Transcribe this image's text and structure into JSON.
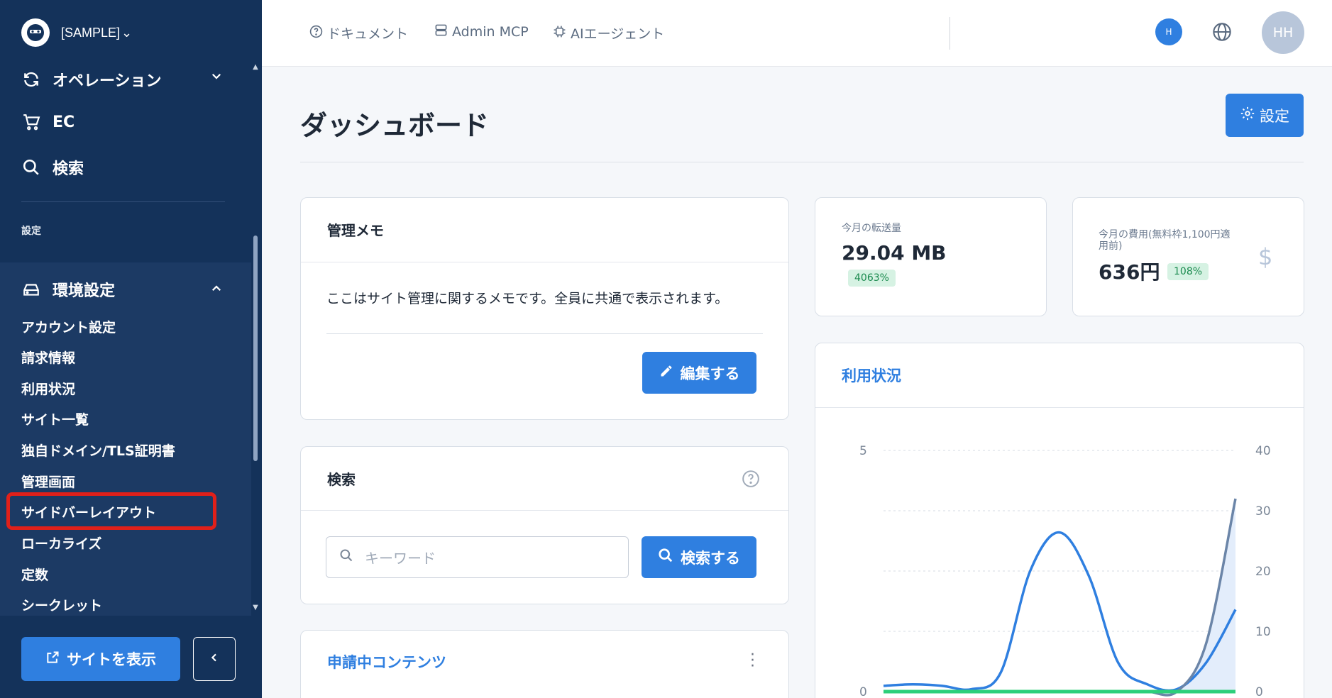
{
  "sidebar": {
    "site_name": "[SAMPLE]",
    "nav": [
      {
        "label": "オペレーション",
        "icon": "refresh-icon"
      },
      {
        "label": "EC",
        "icon": "cart-icon"
      },
      {
        "label": "検索",
        "icon": "search-icon"
      }
    ],
    "section_label": "設定",
    "env_settings": {
      "label": "環境設定",
      "icon": "drive-icon",
      "items": [
        "アカウント設定",
        "請求情報",
        "利用状況",
        "サイト一覧",
        "独自ドメイン/TLS証明書",
        "管理画面",
        "サイドバーレイアウト",
        "ローカライズ",
        "定数",
        "シークレット"
      ],
      "highlighted_item": "サイドバーレイアウト"
    },
    "view_site_label": "サイトを表示"
  },
  "header": {
    "links": [
      {
        "label": "ドキュメント",
        "icon": "help-circle-icon"
      },
      {
        "label": "Admin MCP",
        "icon": "server-icon"
      },
      {
        "label": "AIエージェント",
        "icon": "chip-icon"
      }
    ],
    "avatar_small": "H",
    "avatar_initials": "HH"
  },
  "main": {
    "title": "ダッシュボード",
    "settings_label": "設定",
    "memo": {
      "title": "管理メモ",
      "text": "ここはサイト管理に関するメモです。全員に共通で表示されます。",
      "edit_label": "編集する"
    },
    "search": {
      "title": "検索",
      "placeholder": "キーワード",
      "button_label": "検索する"
    },
    "pending": {
      "title": "申請中コンテンツ"
    },
    "transfer": {
      "label": "今月の転送量",
      "value": "29.04 MB",
      "badge": "4063%"
    },
    "cost": {
      "label_line1": "今月の費用(無料枠1,100円適",
      "label_line2": "用前)",
      "value": "636円",
      "badge": "108%"
    },
    "usage": {
      "title": "利用状況"
    }
  },
  "colors": {
    "accent": "#2f7fe0",
    "sidebar": "#14325a",
    "highlight": "#e0201a",
    "badge_bg": "#d6f2e3",
    "badge_text": "#1a8a4e"
  },
  "chart_data": {
    "type": "line",
    "y_left": {
      "ticks": [
        "5",
        "0"
      ],
      "ylim": [
        0,
        5
      ]
    },
    "y_right": {
      "ticks": [
        "40",
        "30",
        "20",
        "10",
        "0"
      ],
      "ylim": [
        0,
        40
      ]
    },
    "series": [
      {
        "color": "#2f7fe0",
        "axis": "left",
        "values": [
          0.12,
          0.15,
          0.12,
          0.05,
          0.4,
          2.5,
          3.3,
          2.4,
          0.6,
          0.15,
          0.05,
          0.6,
          1.7
        ]
      },
      {
        "color": "#6b85a8",
        "axis": "right",
        "values": [
          0,
          0,
          0,
          0,
          0,
          0,
          0,
          0,
          0,
          0,
          0,
          8,
          32
        ]
      },
      {
        "color": "#2ccf7a",
        "axis": "left",
        "values": [
          0,
          0,
          0,
          0,
          0,
          0,
          0,
          0,
          0,
          0,
          0,
          0,
          0
        ]
      }
    ]
  }
}
